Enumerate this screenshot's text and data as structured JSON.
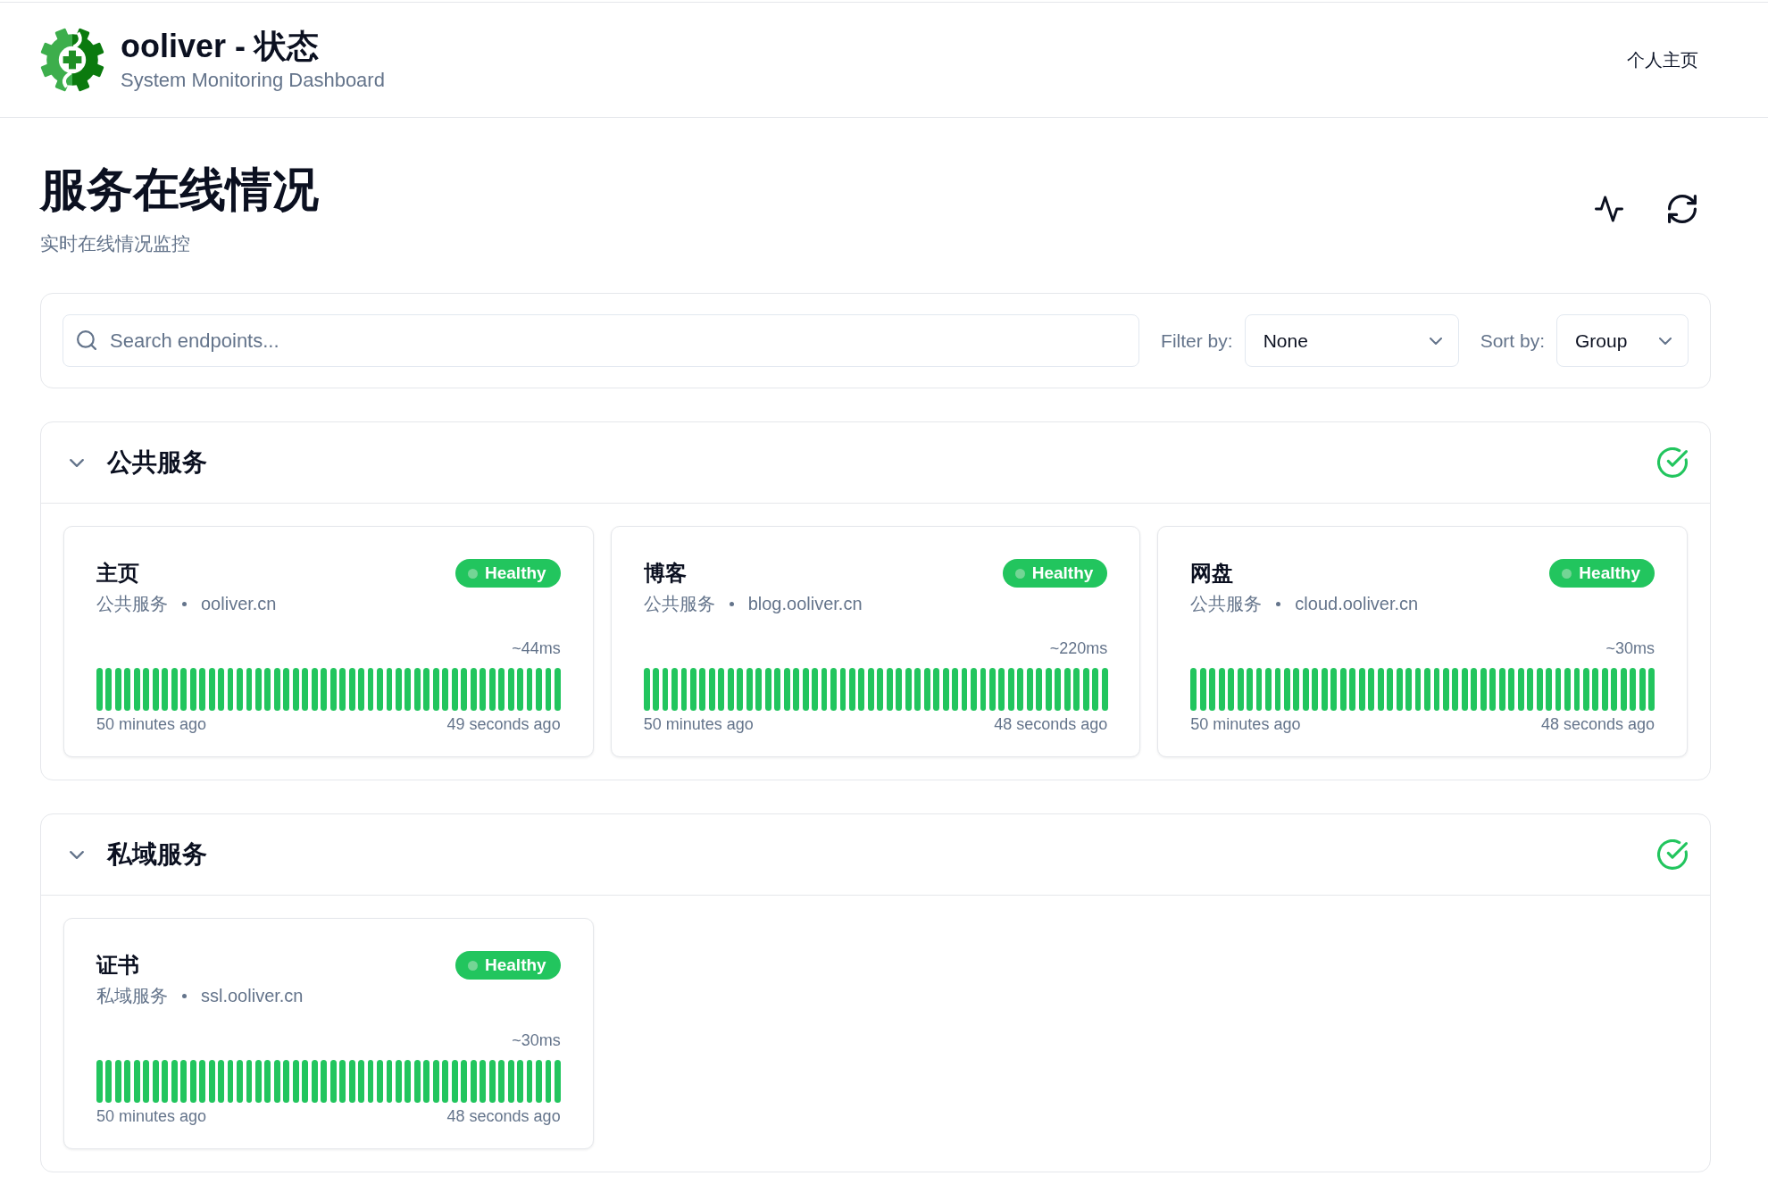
{
  "header": {
    "title": "ooliver - 状态",
    "subtitle": "System Monitoring Dashboard",
    "nav_link": "个人主页"
  },
  "page": {
    "title": "服务在线情况",
    "subtitle": "实时在线情况监控"
  },
  "toolbar": {
    "search": {
      "placeholder": "Search endpoints..."
    },
    "filter": {
      "label": "Filter by:",
      "value": "None"
    },
    "sort": {
      "label": "Sort by:",
      "value": "Group"
    }
  },
  "groups": [
    {
      "name": "公共服务",
      "expanded": true,
      "healthy": true,
      "endpoints": [
        {
          "name": "主页",
          "group": "公共服务",
          "host": "ooliver.cn",
          "status": "Healthy",
          "healthy": true,
          "latency": "~44ms",
          "oldest": "50 minutes ago",
          "newest": "49 seconds ago"
        },
        {
          "name": "博客",
          "group": "公共服务",
          "host": "blog.ooliver.cn",
          "status": "Healthy",
          "healthy": true,
          "latency": "~220ms",
          "oldest": "50 minutes ago",
          "newest": "48 seconds ago"
        },
        {
          "name": "网盘",
          "group": "公共服务",
          "host": "cloud.ooliver.cn",
          "status": "Healthy",
          "healthy": true,
          "latency": "~30ms",
          "oldest": "50 minutes ago",
          "newest": "48 seconds ago"
        }
      ]
    },
    {
      "name": "私域服务",
      "expanded": true,
      "healthy": true,
      "endpoints": [
        {
          "name": "证书",
          "group": "私域服务",
          "host": "ssl.ooliver.cn",
          "status": "Healthy",
          "healthy": true,
          "latency": "~30ms",
          "oldest": "50 minutes ago",
          "newest": "48 seconds ago"
        }
      ]
    }
  ]
}
